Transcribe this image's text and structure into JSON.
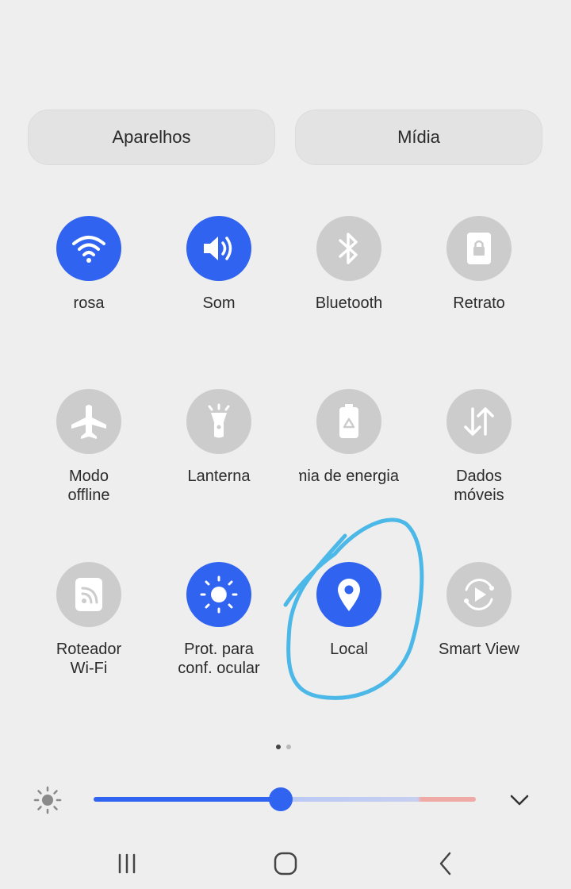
{
  "top_buttons": {
    "devices": "Aparelhos",
    "media": "Mídia"
  },
  "tiles": [
    {
      "label": "rosa",
      "icon": "wifi-icon",
      "on": true
    },
    {
      "label": "Som",
      "icon": "speaker-icon",
      "on": true
    },
    {
      "label": "Bluetooth",
      "icon": "bluetooth-icon",
      "on": false
    },
    {
      "label": "Retrato",
      "icon": "portrait-lock-icon",
      "on": false
    },
    {
      "label": "Modo\noffline",
      "icon": "airplane-icon",
      "on": false
    },
    {
      "label": "Lanterna",
      "icon": "flashlight-icon",
      "on": false
    },
    {
      "label": "Economia de energia",
      "icon": "battery-saver-icon",
      "on": false
    },
    {
      "label": "Dados\nmóveis",
      "icon": "mobile-data-icon",
      "on": false
    },
    {
      "label": "Roteador\nWi-Fi",
      "icon": "hotspot-icon",
      "on": false
    },
    {
      "label": "Prot. para\nconf. ocular",
      "icon": "eye-comfort-icon",
      "on": true
    },
    {
      "label": "Local",
      "icon": "location-icon",
      "on": true
    },
    {
      "label": "Smart View",
      "icon": "smart-view-icon",
      "on": false
    }
  ],
  "brightness": {
    "level": 0.49
  },
  "colors": {
    "accent": "#2f63f0",
    "inactive": "#cccccc",
    "annotation": "#4bb8e8"
  }
}
